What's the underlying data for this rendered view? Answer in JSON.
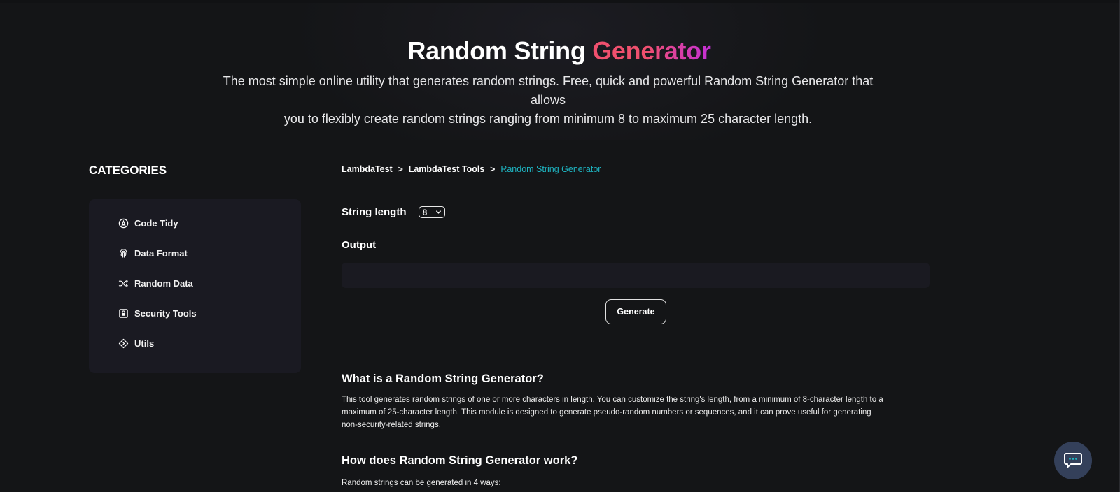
{
  "hero": {
    "title_main": "Random String ",
    "title_accent": "Generator",
    "description_line1": "The most simple online utility that generates random strings. Free, quick and powerful Random String Generator that allows",
    "description_line2": "you to flexibly create random strings ranging from minimum 8 to maximum 25 character length."
  },
  "sidebar": {
    "title": "CATEGORIES",
    "items": [
      {
        "label": "Code Tidy",
        "icon": "code-tidy-icon"
      },
      {
        "label": "Data Format",
        "icon": "fingerprint-icon"
      },
      {
        "label": "Random Data",
        "icon": "shuffle-icon"
      },
      {
        "label": "Security Tools",
        "icon": "lock-icon"
      },
      {
        "label": "Utils",
        "icon": "utils-diamond-icon"
      }
    ]
  },
  "breadcrumb": {
    "items": [
      "LambdaTest",
      "LambdaTest Tools",
      "Random String Generator"
    ],
    "separator": ">"
  },
  "form": {
    "length_label": "String length",
    "length_value": "8",
    "output_label": "Output",
    "output_value": "",
    "generate_label": "Generate"
  },
  "content": {
    "section1_heading": "What is a Random String Generator?",
    "section1_line1": "This tool generates random strings of one or more characters in length. You can customize the string's length, from a minimum of 8-character length to a",
    "section1_line2": "maximum of 25-character length. This module is designed to generate pseudo-random numbers or sequences, and it can prove useful for generating",
    "section1_line3": "non-security-related strings.",
    "section2_heading": "How does Random String Generator work?",
    "section2_intro": "Random strings can be generated in 4 ways:"
  },
  "colors": {
    "background": "#141517",
    "panel": "#1a1a22",
    "breadcrumb_active": "#1eb5c2",
    "title_accent_start": "#f0506e",
    "title_accent_end": "#c42fd8",
    "chat_button": "#34405a"
  }
}
